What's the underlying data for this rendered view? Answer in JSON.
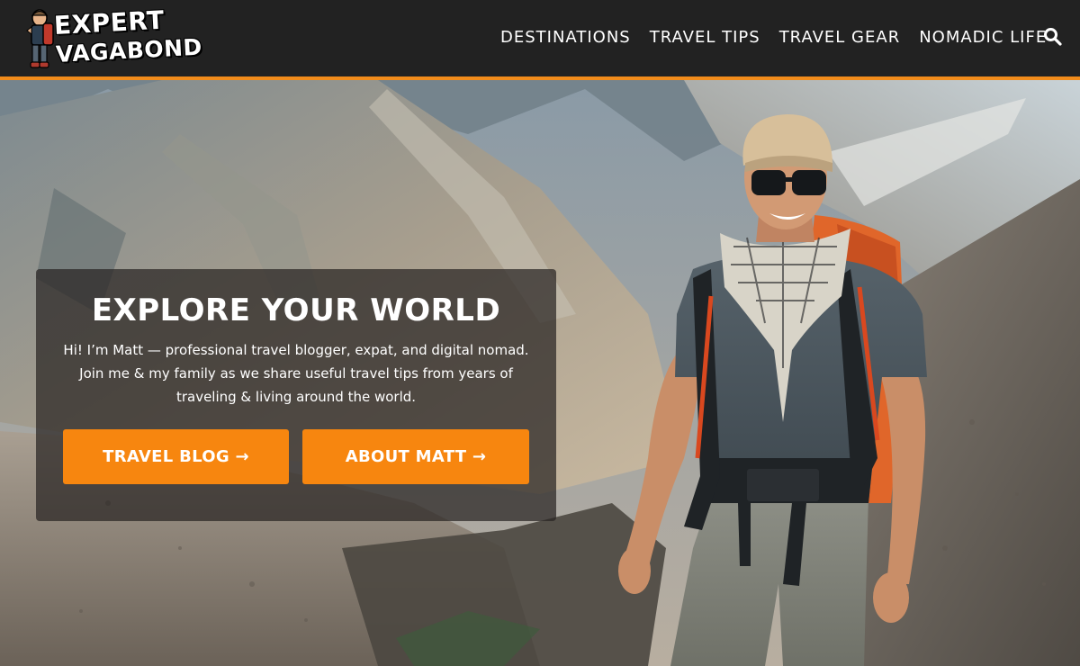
{
  "brand": {
    "line1": "EXPERT",
    "line2": "VAGABOND",
    "figure_icon": "backpacker-mascot"
  },
  "nav": {
    "items": [
      {
        "label": "DESTINATIONS"
      },
      {
        "label": "TRAVEL TIPS"
      },
      {
        "label": "TRAVEL GEAR"
      },
      {
        "label": "NOMADIC LIFE"
      }
    ],
    "search_icon": "search-icon"
  },
  "hero": {
    "title": "EXPLORE YOUR WORLD",
    "text": "Hi! I’m Matt — professional travel blogger, expat, and digital nomad. Join me & my family as we share useful travel tips from years of traveling & living around the world.",
    "buttons": {
      "blog": "TRAVEL BLOG →",
      "about": "ABOUT MATT →"
    },
    "image": "hiker-with-backpack-in-mountains"
  },
  "colors": {
    "header_bg": "#222222",
    "accent": "#f28c1b",
    "button": "#f7860f",
    "card_overlay": "rgba(40,36,34,0.72)"
  }
}
